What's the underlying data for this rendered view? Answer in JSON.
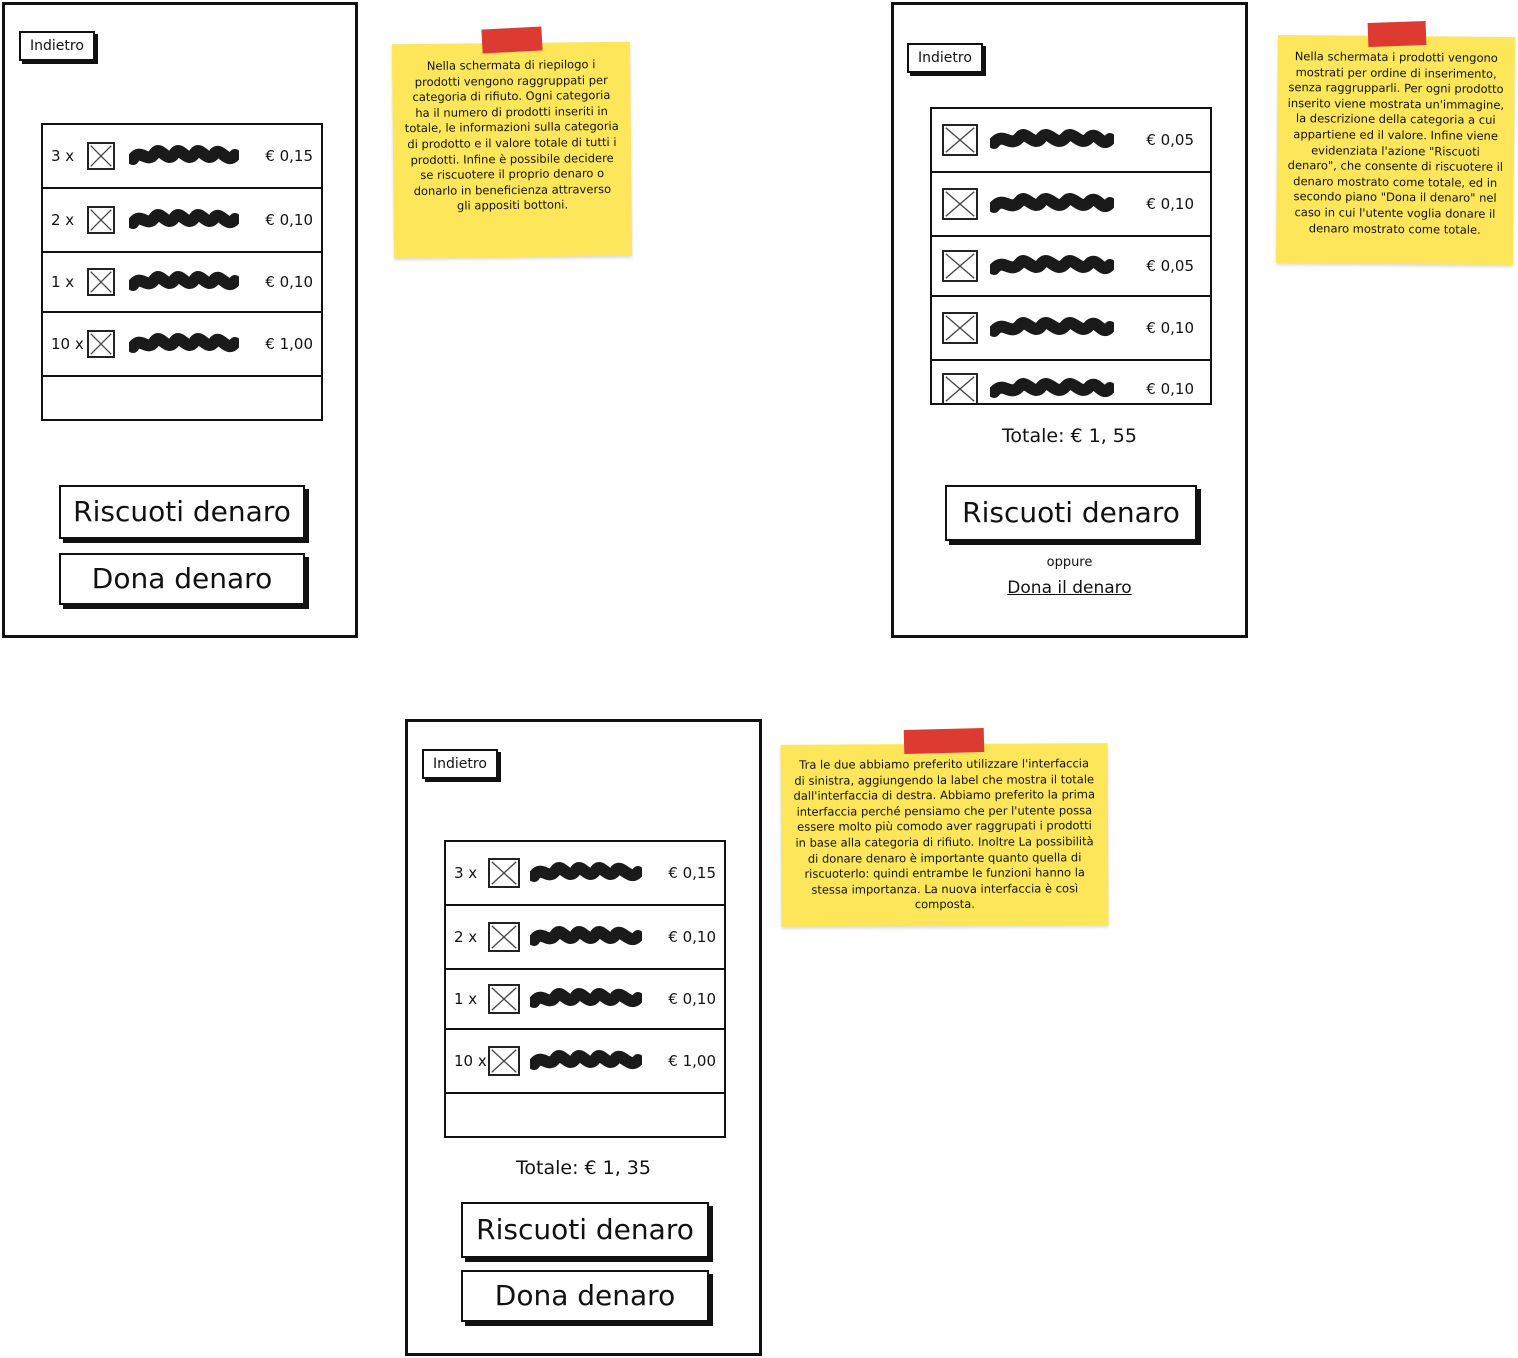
{
  "mockup_left": {
    "back_label": "Indietro",
    "items": [
      {
        "qty": "3 x",
        "price": "€ 0,15"
      },
      {
        "qty": "2 x",
        "price": "€ 0,10"
      },
      {
        "qty": "1 x",
        "price": "€ 0,10"
      },
      {
        "qty": "10 x",
        "price": "€ 1,00"
      }
    ],
    "collect_label": "Riscuoti denaro",
    "donate_label": "Dona denaro"
  },
  "mockup_right": {
    "back_label": "Indietro",
    "items": [
      {
        "price": "€ 0,05"
      },
      {
        "price": "€ 0,10"
      },
      {
        "price": "€ 0,05"
      },
      {
        "price": "€ 0,10"
      },
      {
        "price": "€ 0,10"
      }
    ],
    "total_label": "Totale: € 1, 55",
    "collect_label": "Riscuoti denaro",
    "or_label": "oppure",
    "donate_link": "Dona il denaro"
  },
  "mockup_final": {
    "back_label": "Indietro",
    "items": [
      {
        "qty": "3 x",
        "price": "€ 0,15"
      },
      {
        "qty": "2 x",
        "price": "€ 0,10"
      },
      {
        "qty": "1 x",
        "price": "€ 0,10"
      },
      {
        "qty": "10 x",
        "price": "€ 1,00"
      }
    ],
    "total_label": "Totale: € 1, 35",
    "collect_label": "Riscuoti denaro",
    "donate_label": "Dona denaro"
  },
  "notes": {
    "left": "Nella schermata di riepilogo i prodotti vengono raggruppati per categoria di rifiuto. Ogni categoria ha il numero di prodotti inseriti in totale, le informazioni sulla categoria di prodotto e il valore totale di tutti i prodotti. Infine è possibile decidere se riscuotere il proprio denaro o donarlo in beneficienza attraverso gli appositi bottoni.",
    "right": "Nella schermata i prodotti vengono mostrati per ordine di inserimento, senza raggrupparli. Per ogni prodotto inserito viene mostrata un'immagine, la descrizione della categoria a cui appartiene ed il valore. Infine viene evidenziata l'azione \"Riscuoti denaro\", che consente di riscuotere il denaro mostrato come totale, ed in secondo piano \"Dona il denaro\" nel caso in cui l'utente voglia donare il denaro mostrato come totale.",
    "bottom": "Tra le due abbiamo preferito utilizzare l'interfaccia di sinistra, aggiungendo la label che mostra il totale dall'interfaccia di destra. Abbiamo preferito la prima interfaccia perché pensiamo che per l'utente possa essere molto più comodo aver raggrupati i prodotti in base alla categoria di rifiuto. Inoltre La possibilità di donare denaro è importante quanto quella di riscuoterlo: quindi entrambe le funzioni hanno la stessa importanza. La nuova interfaccia è così composta."
  },
  "colors": {
    "note_yellow": "#fde65a",
    "tape_red": "#dd3a32",
    "ink": "#111111"
  }
}
